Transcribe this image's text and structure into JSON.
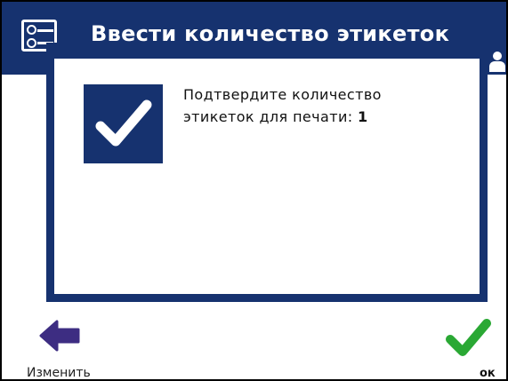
{
  "header": {
    "title": "Ввести количество этикеток",
    "icon": "label-card-icon",
    "user_icon": "user-icon"
  },
  "dialog": {
    "icon": "checkmark-icon",
    "message_line1": "Подтвердите количество",
    "message_prefix": "этикеток для печати: ",
    "count": "1"
  },
  "footer": {
    "back_label": "Изменить",
    "ok_label": "ок"
  },
  "colors": {
    "primary": "#16326f",
    "back_arrow": "#3d2d82",
    "ok_check": "#2aa834"
  }
}
